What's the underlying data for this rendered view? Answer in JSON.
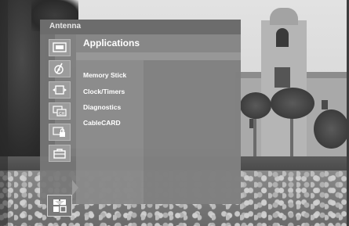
{
  "menu": {
    "title": "Antenna",
    "section_title": "Applications",
    "items": [
      {
        "label": "Memory Stick"
      },
      {
        "label": "Clock/Timers"
      },
      {
        "label": "Diagnostics"
      },
      {
        "label": "CableCARD"
      }
    ],
    "categories": [
      {
        "icon": "picture-icon"
      },
      {
        "icon": "sound-icon"
      },
      {
        "icon": "screen-icon"
      },
      {
        "icon": "channel-icon"
      },
      {
        "icon": "parental-lock-icon"
      },
      {
        "icon": "setup-icon"
      },
      {
        "icon": "applications-icon",
        "selected": true
      }
    ]
  },
  "colors": {
    "menu_bg": "#787878",
    "header_bg": "#6c6c6c",
    "text": "#ffffff"
  }
}
